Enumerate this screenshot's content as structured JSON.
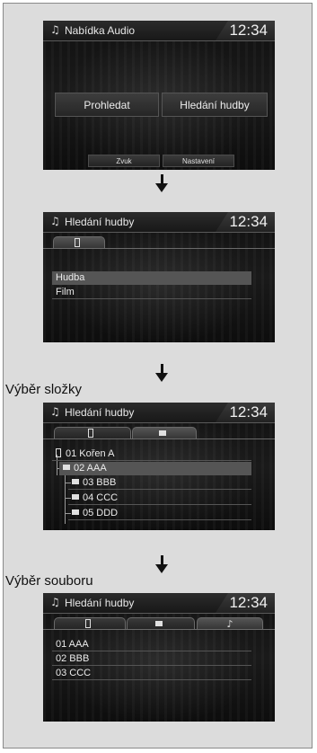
{
  "screens": {
    "audio_menu": {
      "title": "Nabídka Audio",
      "clock": "12:34",
      "buttons": {
        "search": "Prohledat",
        "music_search": "Hledání hudby",
        "sound": "Zvuk",
        "settings": "Nastavení"
      }
    },
    "music_search": {
      "title": "Hledání hudby",
      "clock": "12:34",
      "items": [
        "Hudba",
        "Film"
      ]
    },
    "folder_select": {
      "label": "Výběr složky",
      "title": "Hledání hudby",
      "clock": "12:34",
      "items": [
        "01 Kořen A",
        "02 AAA",
        "03 BBB",
        "04 CCC",
        "05 DDD"
      ]
    },
    "file_select": {
      "label": "Výběr souboru",
      "title": "Hledání hudby",
      "clock": "12:34",
      "items": [
        "01 AAA",
        "02 BBB",
        "03 CCC"
      ]
    }
  },
  "icons": [
    "music-note-icon",
    "usb-icon",
    "folder-icon",
    "down-arrow-icon"
  ],
  "colors": {
    "screen_bg": "#141414",
    "highlight_row": "#555555",
    "page_bg": "#dcdcdc"
  }
}
